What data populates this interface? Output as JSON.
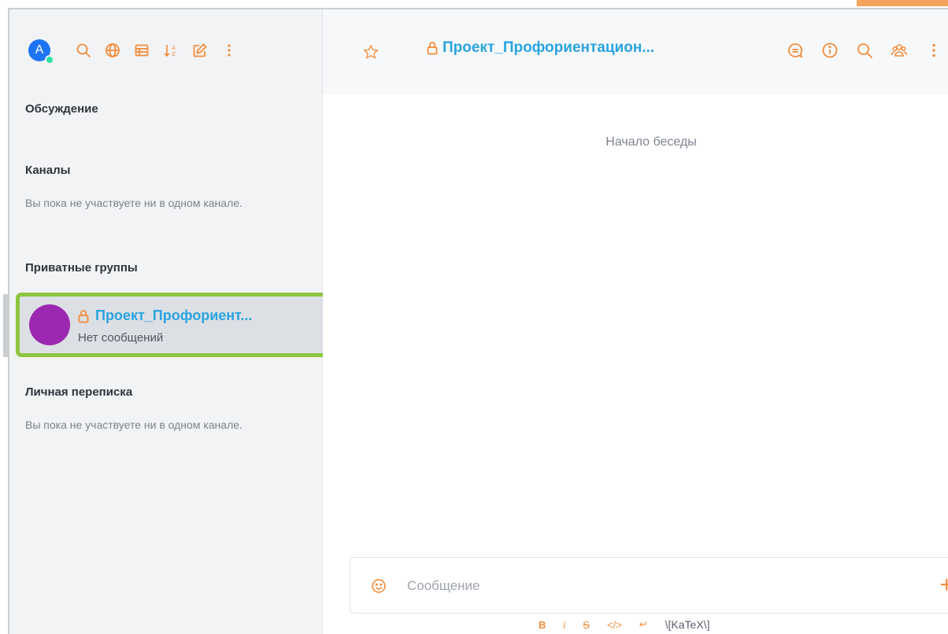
{
  "user": {
    "avatar_letter": "A"
  },
  "sidebar": {
    "sections": {
      "discussion": "Обсуждение",
      "channels": "Каналы",
      "private_groups": "Приватные группы",
      "direct_messages": "Личная переписка"
    },
    "empty_channels": "Вы пока не участвуете ни в одном канале.",
    "empty_direct": "Вы пока не участвуете ни в одном канале.",
    "room": {
      "name": "Проект_Профориент...",
      "last_message": "Нет сообщений"
    }
  },
  "main": {
    "title": "Проект_Профориентацион...",
    "conversation_start": "Начало беседы",
    "composer": {
      "placeholder": "Сообщение"
    },
    "format": {
      "bold": "B",
      "italic": "i",
      "strike": "S",
      "code": "</>",
      "multiline": "↵",
      "katex": "\\[KaTeX\\]"
    }
  },
  "colors": {
    "accent": "#f38c39",
    "link": "#2aa4e0",
    "selection_border": "#8dc63f",
    "room_avatar": "#9c27b0",
    "user_avatar": "#1d74f5",
    "online": "#2de0a5"
  }
}
